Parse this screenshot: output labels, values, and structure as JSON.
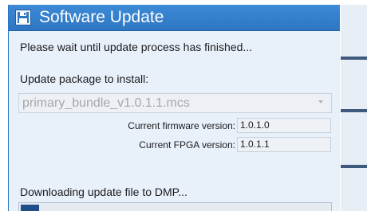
{
  "dialog": {
    "title": "Software Update",
    "title_icon": "floppy-disk-icon",
    "wait_message": "Please wait until update process has finished...",
    "package_label": "Update package to install:",
    "package_select_value": "primary_bundle_v1.0.1.1.mcs",
    "firmware_label": "Current firmware version:",
    "firmware_value": "1.0.1.0",
    "fpga_label": "Current FPGA version:",
    "fpga_value": "1.0.1.1",
    "download_status": "Downloading update file to DMP...",
    "progress": 0.06
  },
  "colors": {
    "titlebar": "#3c8ad6",
    "dialog_background": "#e8f0fa",
    "progress_fill": "#1f4f8a"
  }
}
